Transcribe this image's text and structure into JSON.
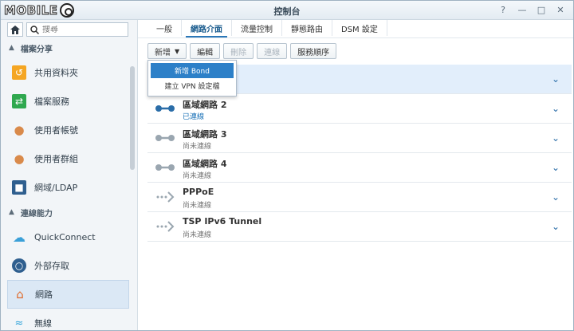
{
  "window": {
    "title": "控制台",
    "logo_text": "MOBILE"
  },
  "sidebar": {
    "search_placeholder": "搜尋",
    "sections": [
      {
        "label": "檔案分享"
      },
      {
        "label": "連線能力"
      }
    ],
    "items": [
      {
        "label": "共用資料夾",
        "color": "#f5a623"
      },
      {
        "label": "檔案服務",
        "color": "#2fa84f"
      },
      {
        "label": "使用者帳號",
        "color": "#d98a4b"
      },
      {
        "label": "使用者群組",
        "color": "#d98a4b"
      },
      {
        "label": "網域/LDAP",
        "color": "#2f5f8f"
      },
      {
        "label": "QuickConnect",
        "color": "#3aa0d8"
      },
      {
        "label": "外部存取",
        "color": "#2f5f8f"
      },
      {
        "label": "網路",
        "color": "#e06a2a"
      },
      {
        "label": "無線",
        "color": "#2aa0d8"
      }
    ]
  },
  "tabs": [
    {
      "label": "一般"
    },
    {
      "label": "網路介面"
    },
    {
      "label": "流量控制"
    },
    {
      "label": "靜態路由"
    },
    {
      "label": "DSM 設定"
    }
  ],
  "toolbar": {
    "add_label": "新增",
    "edit_label": "編輯",
    "delete_label": "刪除",
    "connect_label": "連線",
    "service_order_label": "服務順序"
  },
  "dropdown": {
    "items": [
      {
        "label": "新增 Bond"
      },
      {
        "label": "建立 VPN 設定檔"
      }
    ]
  },
  "interfaces": [
    {
      "name": "",
      "status": ""
    },
    {
      "name": "區域網路 2",
      "status": "已連線"
    },
    {
      "name": "區域網路 3",
      "status": "尚未連線"
    },
    {
      "name": "區域網路 4",
      "status": "尚未連線"
    },
    {
      "name": "PPPoE",
      "status": "尚未連線"
    },
    {
      "name": "TSP IPv6 Tunnel",
      "status": "尚未連線"
    }
  ],
  "colors": {
    "accent": "#2d80c8",
    "connected": "#1c73b8",
    "disconnected_icon": "#9aa6b0"
  }
}
